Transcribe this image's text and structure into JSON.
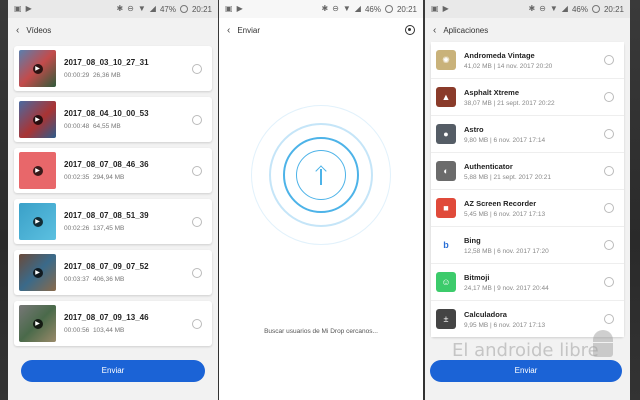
{
  "status_left": {
    "s1": [
      "▣",
      "▶"
    ],
    "s2": [
      "▣",
      "▶"
    ],
    "s3": [
      "▣",
      "▶"
    ]
  },
  "status_right": {
    "s1": {
      "battery": "47%",
      "time": "20:21"
    },
    "s2": {
      "battery": "46%",
      "time": "20:21"
    },
    "s3": {
      "battery": "46%",
      "time": "20:21"
    }
  },
  "videos_screen": {
    "title": "Vídeos",
    "items": [
      {
        "name": "2017_08_03_10_27_31",
        "duration": "00:00:29",
        "size": "26,36 MB"
      },
      {
        "name": "2017_08_04_10_00_53",
        "duration": "00:00:48",
        "size": "64,55 MB"
      },
      {
        "name": "2017_08_07_08_46_36",
        "duration": "00:02:35",
        "size": "294,94 MB"
      },
      {
        "name": "2017_08_07_08_51_39",
        "duration": "00:02:26",
        "size": "137,45 MB"
      },
      {
        "name": "2017_08_07_09_07_52",
        "duration": "00:03:37",
        "size": "406,36 MB"
      },
      {
        "name": "2017_08_07_09_13_46",
        "duration": "00:00:56",
        "size": "103,44 MB"
      }
    ],
    "send_button": "Enviar"
  },
  "send_screen": {
    "title": "Enviar",
    "search_text": "Buscar usuarios de Mi Drop cercanos..."
  },
  "apps_screen": {
    "title": "Aplicaciones",
    "items": [
      {
        "name": "Andromeda Vintage",
        "meta": "41,02 MB | 14 nov. 2017 20:20",
        "icon": "✺",
        "color": "#c9b27a"
      },
      {
        "name": "Asphalt Xtreme",
        "meta": "38,07 MB | 21 sept. 2017 20:22",
        "icon": "▲",
        "color": "#8a3b2a"
      },
      {
        "name": "Astro",
        "meta": "9,80 MB | 6 nov. 2017 17:14",
        "icon": "●",
        "color": "#555d66"
      },
      {
        "name": "Authenticator",
        "meta": "5,88 MB | 21 sept. 2017 20:21",
        "icon": "◐",
        "color": "#6b6b6b"
      },
      {
        "name": "AZ Screen Recorder",
        "meta": "5,45 MB | 6 nov. 2017 17:13",
        "icon": "■",
        "color": "#e04a3a"
      },
      {
        "name": "Bing",
        "meta": "12,58 MB | 6 nov. 2017 17:20",
        "icon": "b",
        "color": "#ffffff"
      },
      {
        "name": "Bitmoji",
        "meta": "24,17 MB | 9 nov. 2017 20:44",
        "icon": "☺",
        "color": "#3ccb6b"
      },
      {
        "name": "Calculadora",
        "meta": "9,95 MB | 6 nov. 2017 17:13",
        "icon": "±",
        "color": "#444"
      }
    ],
    "send_button": "Enviar"
  },
  "colors": {
    "accent": "#1b63d6",
    "ring": "#4db3e8"
  },
  "watermark": "El androide libre"
}
